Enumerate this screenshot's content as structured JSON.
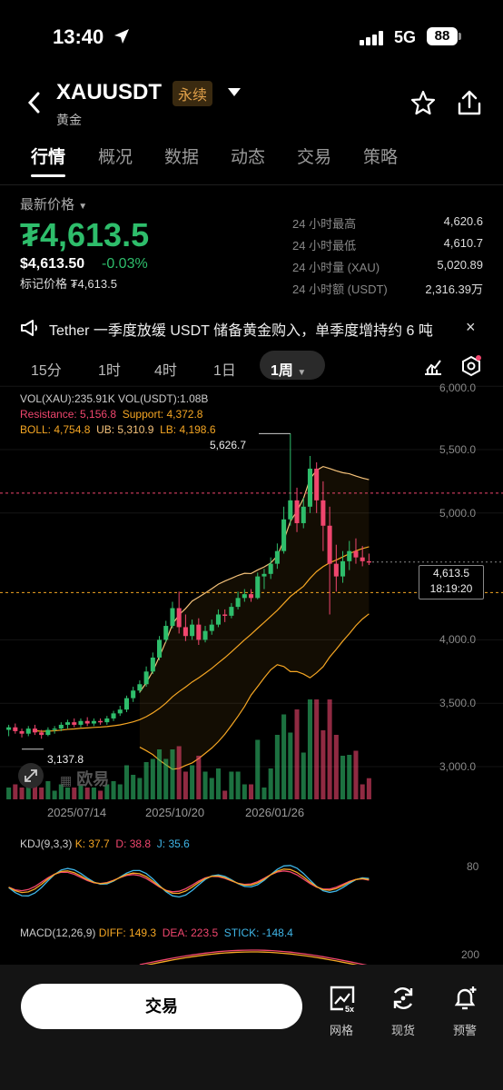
{
  "status": {
    "time": "13:40",
    "network": "5G",
    "battery": "88"
  },
  "header": {
    "symbol": "XAUUSDT",
    "perpetual_badge": "永续",
    "subname": "黄金"
  },
  "tabs": [
    "行情",
    "概况",
    "数据",
    "动态",
    "交易",
    "策略"
  ],
  "price": {
    "latest_label": "最新价格",
    "latest_price": "₮4,613.5",
    "usd_price": "$4,613.50",
    "change": "-0.03%",
    "mark_price": "标记价格 ₮4,613.5"
  },
  "stats": [
    {
      "label": "24 小时最高",
      "value": "4,620.6"
    },
    {
      "label": "24 小时最低",
      "value": "4,610.7"
    },
    {
      "label": "24 小时量 (XAU)",
      "value": "5,020.89"
    },
    {
      "label": "24 小时额 (USDT)",
      "value": "2,316.39万"
    }
  ],
  "news": {
    "text": "Tether 一季度放缓 USDT 储备黄金购入，单季度增持约 6 吨",
    "close": "×"
  },
  "intervals": [
    "15分",
    "1时",
    "4时",
    "1日",
    "1周"
  ],
  "active_interval": "1周",
  "chart": {
    "vol_legend": "VOL(XAU):235.91K  VOL(USDT):1.08B",
    "resistance": "Resistance: 5,156.8",
    "support": "Support: 4,372.8",
    "boll": "BOLL: 4,754.8",
    "ub": "UB: 5,310.9",
    "lb": "LB: 4,198.6",
    "price_ticks": [
      "6,000.0",
      "5,500.0",
      "5,000.0",
      "4,000.0",
      "3,500.0",
      "3,000.0"
    ],
    "current_price": "4,613.5",
    "countdown": "18:19:20",
    "high_label": "5,626.7",
    "low_label": "3,137.8",
    "watermark": "欧易",
    "dates": [
      "2025/07/14",
      "2025/10/20",
      "2026/01/26"
    ]
  },
  "kdj": {
    "name": "KDJ(9,3,3)",
    "k": "K: 37.7",
    "d": "D: 38.8",
    "j": "J: 35.6",
    "tick": "80"
  },
  "macd": {
    "name": "MACD(12,26,9)",
    "diff": "DIFF: 149.3",
    "dea": "DEA: 223.5",
    "stick": "STICK: -148.4",
    "tick": "200"
  },
  "bottom": {
    "trade": "交易",
    "grid": "网格",
    "spot": "现货",
    "alert": "预警",
    "grid_badge": "5x"
  },
  "colors": {
    "up": "#2ebd6b",
    "down": "#f0466e",
    "accent": "#f5a623"
  },
  "chart_data": {
    "type": "candlestick",
    "interval": "1周",
    "dates": [
      "2025/07/14",
      "2025/10/20",
      "2026/01/26"
    ],
    "price_axis": [
      3000,
      3500,
      4000,
      5000,
      5500,
      6000
    ],
    "last_price": 4613.5,
    "high": 5626.7,
    "low": 3137.8,
    "resistance": 5156.8,
    "support": 4372.8,
    "boll": {
      "mid": 4754.8,
      "ub": 5310.9,
      "lb": 4198.6
    },
    "kdj": {
      "k": 37.7,
      "d": 38.8,
      "j": 35.6
    },
    "macd": {
      "diff": 149.3,
      "dea": 223.5,
      "stick": -148.4
    },
    "candles": [
      [
        3290,
        3310,
        3240,
        3330
      ],
      [
        3310,
        3280,
        3260,
        3340
      ],
      [
        3280,
        3260,
        3230,
        3300
      ],
      [
        3260,
        3300,
        3240,
        3320
      ],
      [
        3300,
        3270,
        3250,
        3330
      ],
      [
        3270,
        3250,
        3220,
        3290
      ],
      [
        3250,
        3290,
        3240,
        3310
      ],
      [
        3290,
        3300,
        3260,
        3320
      ],
      [
        3300,
        3330,
        3280,
        3350
      ],
      [
        3330,
        3350,
        3300,
        3370
      ],
      [
        3350,
        3330,
        3310,
        3380
      ],
      [
        3330,
        3360,
        3310,
        3380
      ],
      [
        3360,
        3340,
        3320,
        3390
      ],
      [
        3340,
        3360,
        3320,
        3380
      ],
      [
        3360,
        3350,
        3330,
        3380
      ],
      [
        3350,
        3380,
        3330,
        3400
      ],
      [
        3380,
        3420,
        3360,
        3440
      ],
      [
        3420,
        3450,
        3400,
        3480
      ],
      [
        3450,
        3540,
        3430,
        3560
      ],
      [
        3540,
        3600,
        3510,
        3630
      ],
      [
        3600,
        3650,
        3580,
        3680
      ],
      [
        3650,
        3750,
        3630,
        3790
      ],
      [
        3750,
        3860,
        3730,
        3900
      ],
      [
        3860,
        4000,
        3840,
        4030
      ],
      [
        4000,
        4110,
        3980,
        4150
      ],
      [
        4110,
        4250,
        4090,
        4300
      ],
      [
        4250,
        4100,
        4050,
        4380
      ],
      [
        4100,
        4030,
        3990,
        4200
      ],
      [
        4030,
        4120,
        4000,
        4160
      ],
      [
        4120,
        4000,
        3960,
        4170
      ],
      [
        4000,
        4070,
        3980,
        4110
      ],
      [
        4070,
        4120,
        4040,
        4160
      ],
      [
        4120,
        4200,
        4100,
        4240
      ],
      [
        4200,
        4190,
        4140,
        4240
      ],
      [
        4190,
        4260,
        4170,
        4290
      ],
      [
        4260,
        4330,
        4240,
        4380
      ],
      [
        4330,
        4360,
        4300,
        4400
      ],
      [
        4360,
        4330,
        4300,
        4400
      ],
      [
        4330,
        4500,
        4320,
        4530
      ],
      [
        4500,
        4520,
        4400,
        4560
      ],
      [
        4520,
        4600,
        4480,
        4650
      ],
      [
        4600,
        4700,
        4560,
        4760
      ],
      [
        4700,
        4950,
        4680,
        5050
      ],
      [
        4950,
        5100,
        4900,
        5626.7
      ],
      [
        5100,
        4920,
        4850,
        5200
      ],
      [
        4920,
        5050,
        4880,
        5120
      ],
      [
        5050,
        5350,
        5000,
        5450
      ],
      [
        5350,
        5100,
        5000,
        5400
      ],
      [
        5100,
        4900,
        4700,
        5250
      ],
      [
        4900,
        4600,
        4200,
        5050
      ],
      [
        4600,
        4500,
        4380,
        4750
      ],
      [
        4500,
        4620,
        4450,
        4700
      ],
      [
        4620,
        4700,
        4550,
        4780
      ],
      [
        4700,
        4650,
        4600,
        4800
      ],
      [
        4650,
        4620,
        4580,
        4740
      ],
      [
        4620,
        4613.5,
        4590,
        4680
      ]
    ]
  }
}
